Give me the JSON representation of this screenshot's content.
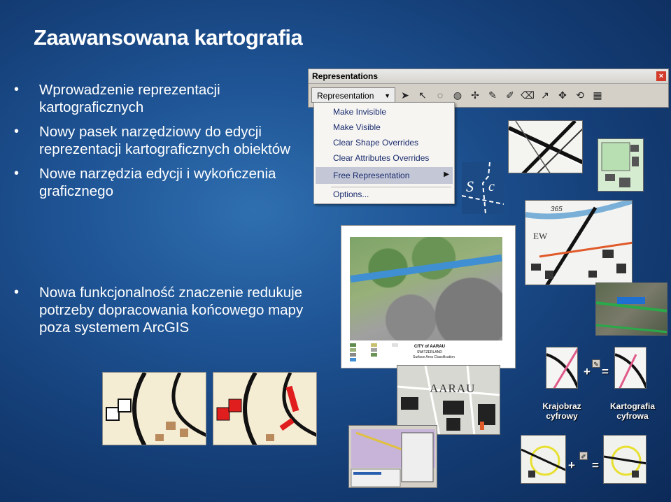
{
  "slide": {
    "title": "Zaawansowana kartografia",
    "bullets_top": [
      "Wprowadzenie reprezentacji kartograficznych",
      "Nowy pasek narzędziowy do edycji reprezentacji kartograficznych obiektów",
      "Nowe narzędzia edycji i wykończenia graficznego"
    ],
    "bullets_bottom": [
      "Nowa funkcjonalność znaczenie redukuje potrzeby dopracowania końcowego mapy poza systemem ArcGIS"
    ]
  },
  "toolbar": {
    "title": "Representations",
    "dropdown_label": "Representation",
    "close_glyph": "×",
    "tool_icons": [
      "select-arrow-icon",
      "direct-select-icon",
      "lasso-icon",
      "lasso-select-icon",
      "marker-icon",
      "pen-icon",
      "vertex-edit-icon",
      "eraser-icon",
      "line-tool-icon",
      "move-icon",
      "rotate-icon",
      "properties-icon"
    ]
  },
  "context_menu": {
    "items": [
      "Make Invisible",
      "Make Visible",
      "Clear Shape Overrides",
      "Clear Attributes Overrides",
      "Free Representation",
      "Options..."
    ],
    "highlighted_index": 4
  },
  "map_labels": {
    "s": "S",
    "c": "c",
    "n365": "365",
    "ew": "EW",
    "aarau": "AARAU",
    "city": "CITY of AARAU",
    "country": "SWITZERLAND",
    "subtitle": "Surface Area Classification"
  },
  "captions": {
    "krajobraz": "Krajobraz cyfrowy",
    "kartografia": "Kartografia cyfrowa",
    "plus": "+",
    "equals": "="
  },
  "colors": {
    "bg_dark": "#0c2a58",
    "bg_light": "#2f6fb0",
    "menu_highlight": "#c3c7d6",
    "highlight_red": "#e01e1e"
  }
}
